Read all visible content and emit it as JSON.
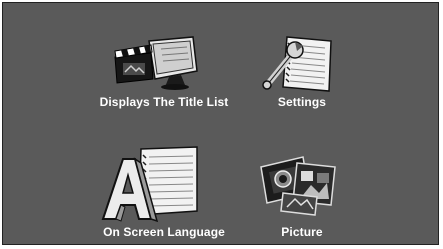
{
  "menu": {
    "items": [
      {
        "label": "Displays The Title List",
        "icon": "title-list-icon"
      },
      {
        "label": "Settings",
        "icon": "settings-icon"
      },
      {
        "label": "On Screen Language",
        "icon": "language-icon"
      },
      {
        "label": "Picture",
        "icon": "picture-icon"
      }
    ]
  },
  "colors": {
    "background": "#5a5a5a",
    "text": "#ffffff"
  }
}
